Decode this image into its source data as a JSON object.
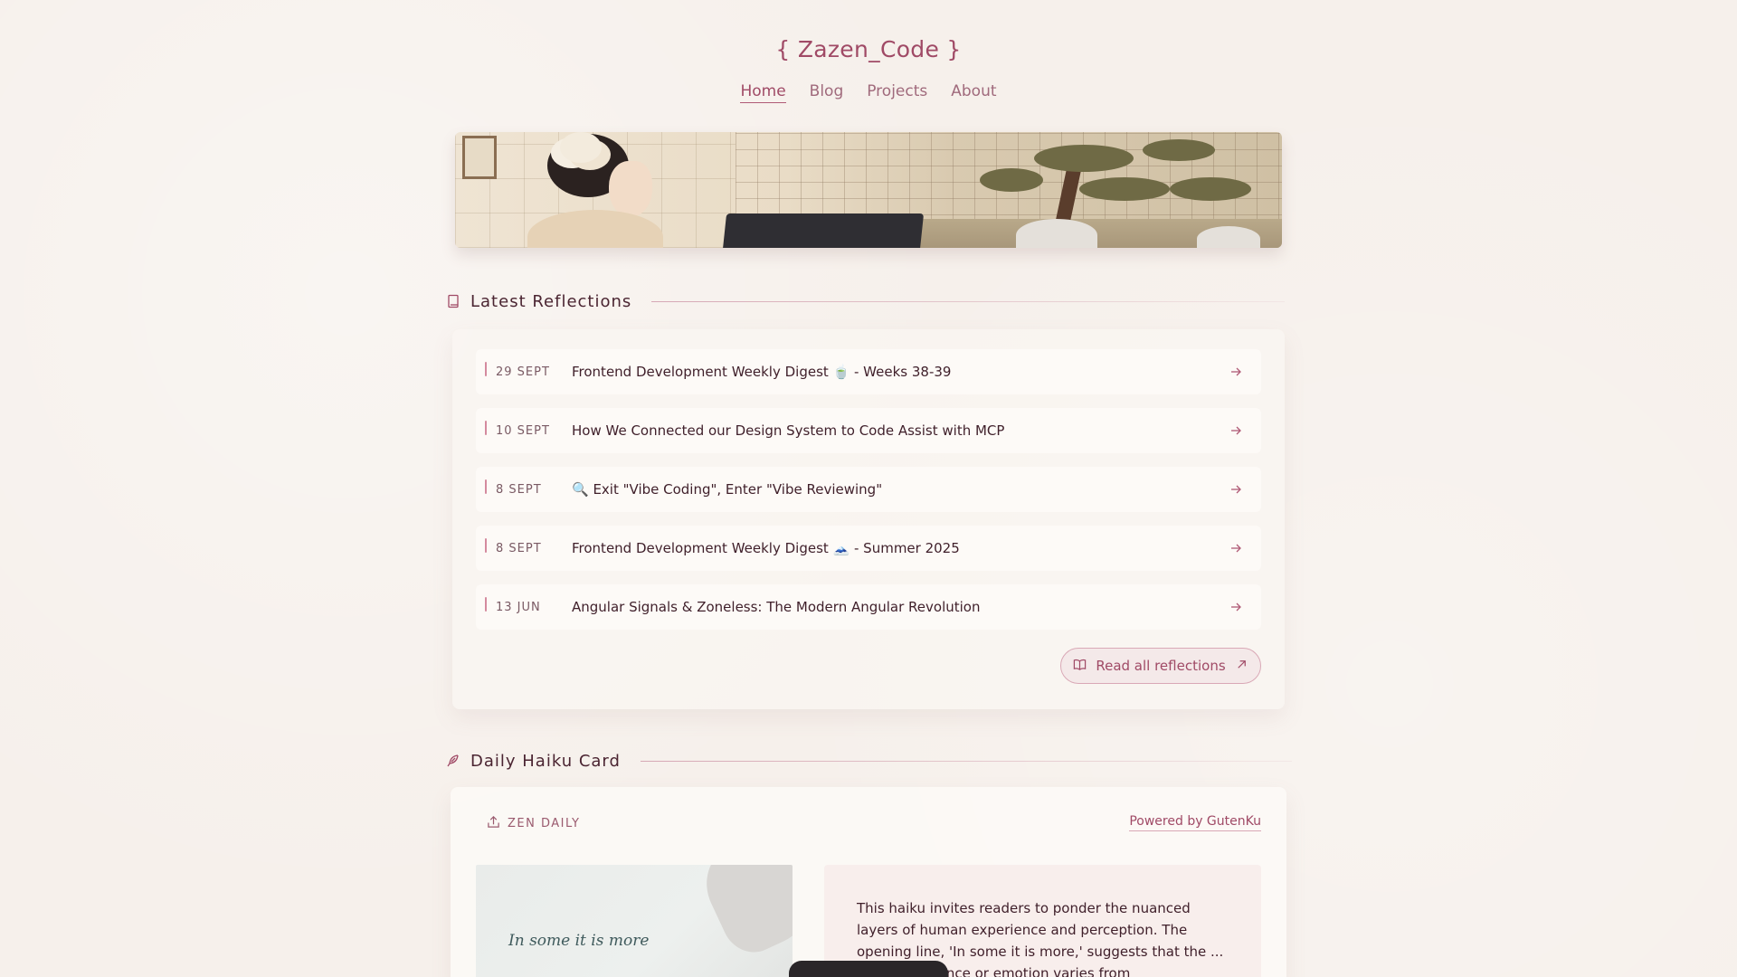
{
  "site": {
    "title": "{ Zazen_Code }"
  },
  "nav": [
    {
      "label": "Home",
      "active": true
    },
    {
      "label": "Blog",
      "active": false
    },
    {
      "label": "Projects",
      "active": false
    },
    {
      "label": "About",
      "active": false
    }
  ],
  "reflections": {
    "heading": "Latest Reflections",
    "icon": "book-icon",
    "items": [
      {
        "date": "29 SEPT",
        "title": "Frontend Development Weekly Digest 🍵 - Weeks 38-39"
      },
      {
        "date": "10 SEPT",
        "title": "How We Connected our Design System to Code Assist with MCP"
      },
      {
        "date": "8 SEPT",
        "title": "🔍 Exit \"Vibe Coding\", Enter \"Vibe Reviewing\""
      },
      {
        "date": "8 SEPT",
        "title": "Frontend Development Weekly Digest 🗻 - Summer 2025"
      },
      {
        "date": "13 JUN",
        "title": "Angular Signals & Zoneless: The Modern Angular Revolution"
      }
    ],
    "read_all_label": "Read all reflections"
  },
  "haiku": {
    "heading": "Daily Haiku Card",
    "icon": "feather-icon",
    "tag": "ZEN DAILY",
    "powered_by": "Powered by GutenKu",
    "image_line": "In some it is more",
    "description": "This haiku invites readers to ponder the nuanced layers of human experience and perception. The opening line, 'In some it is more,' suggests that the ... of an experience or emotion varies from"
  },
  "colors": {
    "accent": "#a04a66",
    "text": "#4a2431",
    "background": "#f6f0eb"
  }
}
